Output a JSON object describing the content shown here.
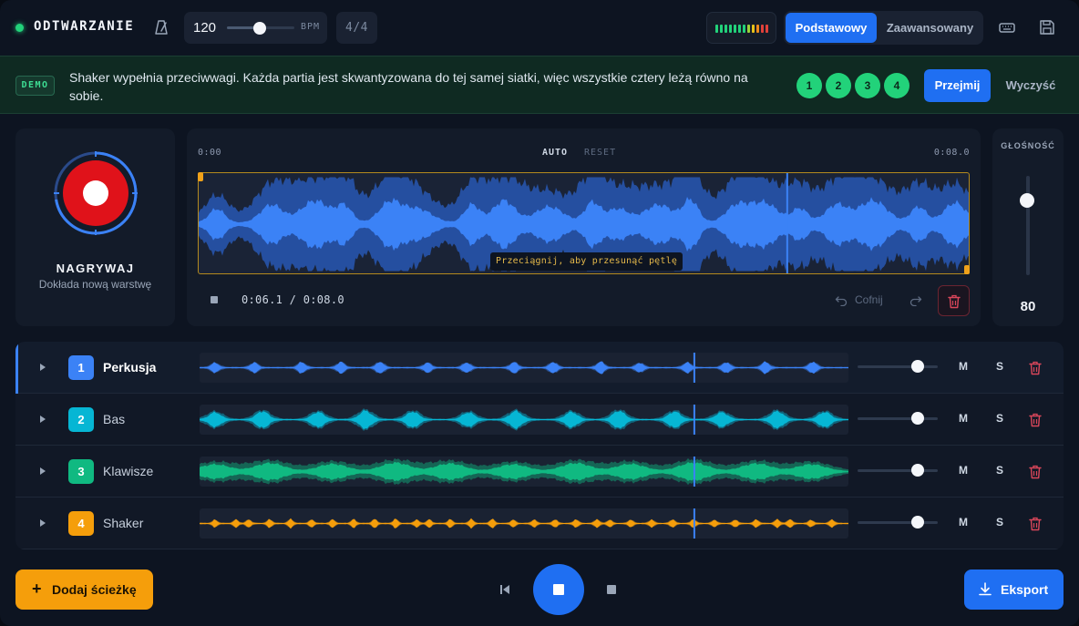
{
  "colors": {
    "accent": "#1f6ff2",
    "record": "#e0121a",
    "green": "#22d27a",
    "danger": "#d9465a"
  },
  "header": {
    "status_label": "ODTWARZANIE",
    "bpm_value": "120",
    "bpm_unit": "BPM",
    "bpm_level": 0.55,
    "time_signature": "4/4",
    "modes": [
      "Podstawowy",
      "Zaawansowany"
    ],
    "active_mode": "Podstawowy",
    "icons": [
      "metronome-icon",
      "keyboard-icon",
      "save-icon"
    ]
  },
  "banner": {
    "badge": "DEMO",
    "text": "Shaker wypełnia przeciwwagi. Każda partia jest skwantyzowana do tej samej siatki, więc wszystkie cztery leżą równo na sobie.",
    "steps": [
      "1",
      "2",
      "3",
      "4"
    ],
    "take_label": "Przejmij",
    "clear_label": "Wyczyść"
  },
  "recorder": {
    "label": "NAGRYWAJ",
    "sublabel": "Dokłada nową warstwę"
  },
  "waveform": {
    "time_start": "0:00",
    "time_end": "0:08.0",
    "auto_label": "AUTO",
    "reset_label": "RESET",
    "loop_tooltip": "Przeciągnij, aby przesunąć pętlę",
    "readout": "0:06.1 / 0:08.0",
    "undo_label": "Cofnij",
    "playhead_fraction": 0.7625
  },
  "volume": {
    "title": "GŁOŚNOŚĆ",
    "value": "80",
    "level": 0.8
  },
  "tracks": [
    {
      "num": "1",
      "name": "Perkusja",
      "color": "#3b82f6",
      "active": true,
      "volume": 0.8,
      "mute_label": "M",
      "solo_label": "S"
    },
    {
      "num": "2",
      "name": "Bas",
      "color": "#06b6d4",
      "active": false,
      "volume": 0.8,
      "mute_label": "M",
      "solo_label": "S"
    },
    {
      "num": "3",
      "name": "Klawisze",
      "color": "#10b981",
      "active": false,
      "volume": 0.8,
      "mute_label": "M",
      "solo_label": "S"
    },
    {
      "num": "4",
      "name": "Shaker",
      "color": "#f59e0b",
      "active": false,
      "volume": 0.8,
      "mute_label": "M",
      "solo_label": "S"
    }
  ],
  "footer": {
    "add_track_label": "Dodaj ścieżkę",
    "export_label": "Eksport"
  }
}
